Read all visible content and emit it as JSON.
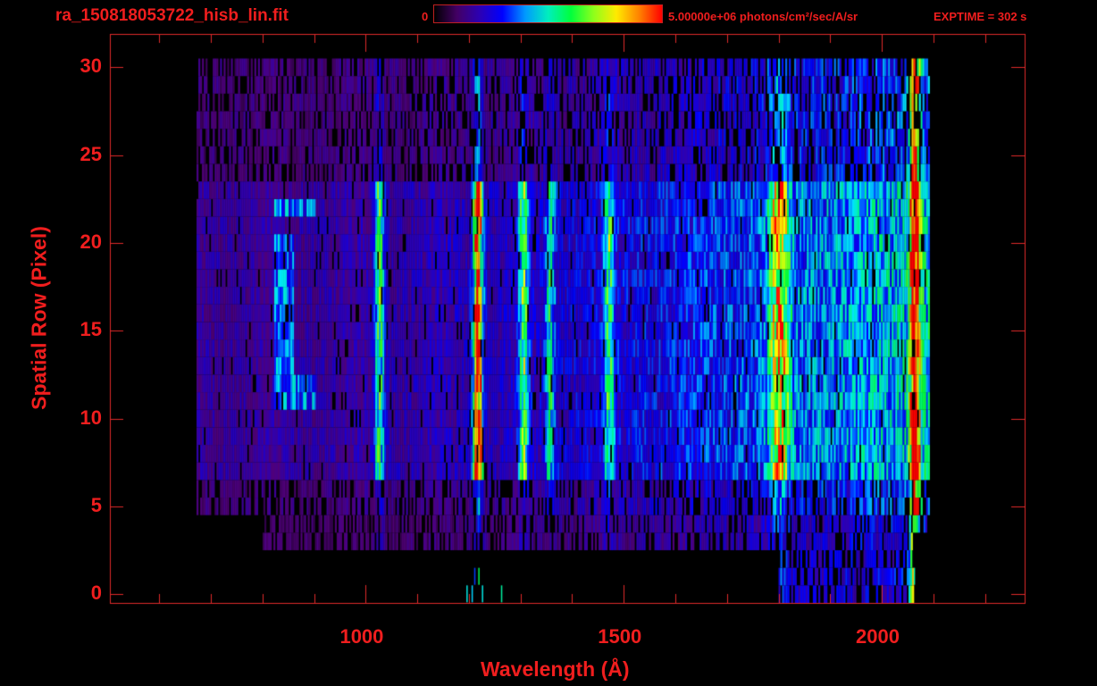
{
  "header": {
    "filename": "ra_150818053722_hisb_lin.fit",
    "colorbar_min": "0",
    "colorbar_max_value": "5.00000e+06",
    "colorbar_units": "photons/cm²/sec/A/sr",
    "exptime": "EXPTIME = 302 s"
  },
  "colors": {
    "axis": "#f01e1e",
    "background": "#000000"
  },
  "chart_data": {
    "type": "heatmap",
    "title": "ra_150818053722_hisb_lin.fit",
    "xlabel": "Wavelength (Å)",
    "ylabel": "Spatial Row (Pixel)",
    "xlim": [
      504,
      2277
    ],
    "ylim": [
      -0.5,
      31.9
    ],
    "xticks": [
      "1000",
      "1500",
      "2000"
    ],
    "xtick_values": [
      1000,
      1500,
      2000
    ],
    "xminor_step": 100,
    "yticks": [
      "0",
      "5",
      "10",
      "15",
      "20",
      "25",
      "30"
    ],
    "ytick_values": [
      0,
      5,
      10,
      15,
      20,
      25,
      30
    ],
    "colorscale": {
      "min": 0,
      "max": 5000000,
      "colormap": "rainbow"
    },
    "data_extent": {
      "wavelength": [
        672,
        2090
      ],
      "rows": [
        0,
        30
      ],
      "bright_rows": [
        7,
        23
      ]
    },
    "emission_features": [
      {
        "wavelength": 1025,
        "relative_intensity": 0.45
      },
      {
        "wavelength": 1216,
        "relative_intensity": 0.95
      },
      {
        "wavelength": 1304,
        "relative_intensity": 0.48
      },
      {
        "wavelength": 1356,
        "relative_intensity": 0.32
      },
      {
        "wavelength": 1470,
        "relative_intensity": 0.4
      },
      {
        "wavelength": 1800,
        "relative_intensity": 0.6
      },
      {
        "wavelength": 2063,
        "relative_intensity": 0.95
      }
    ]
  }
}
